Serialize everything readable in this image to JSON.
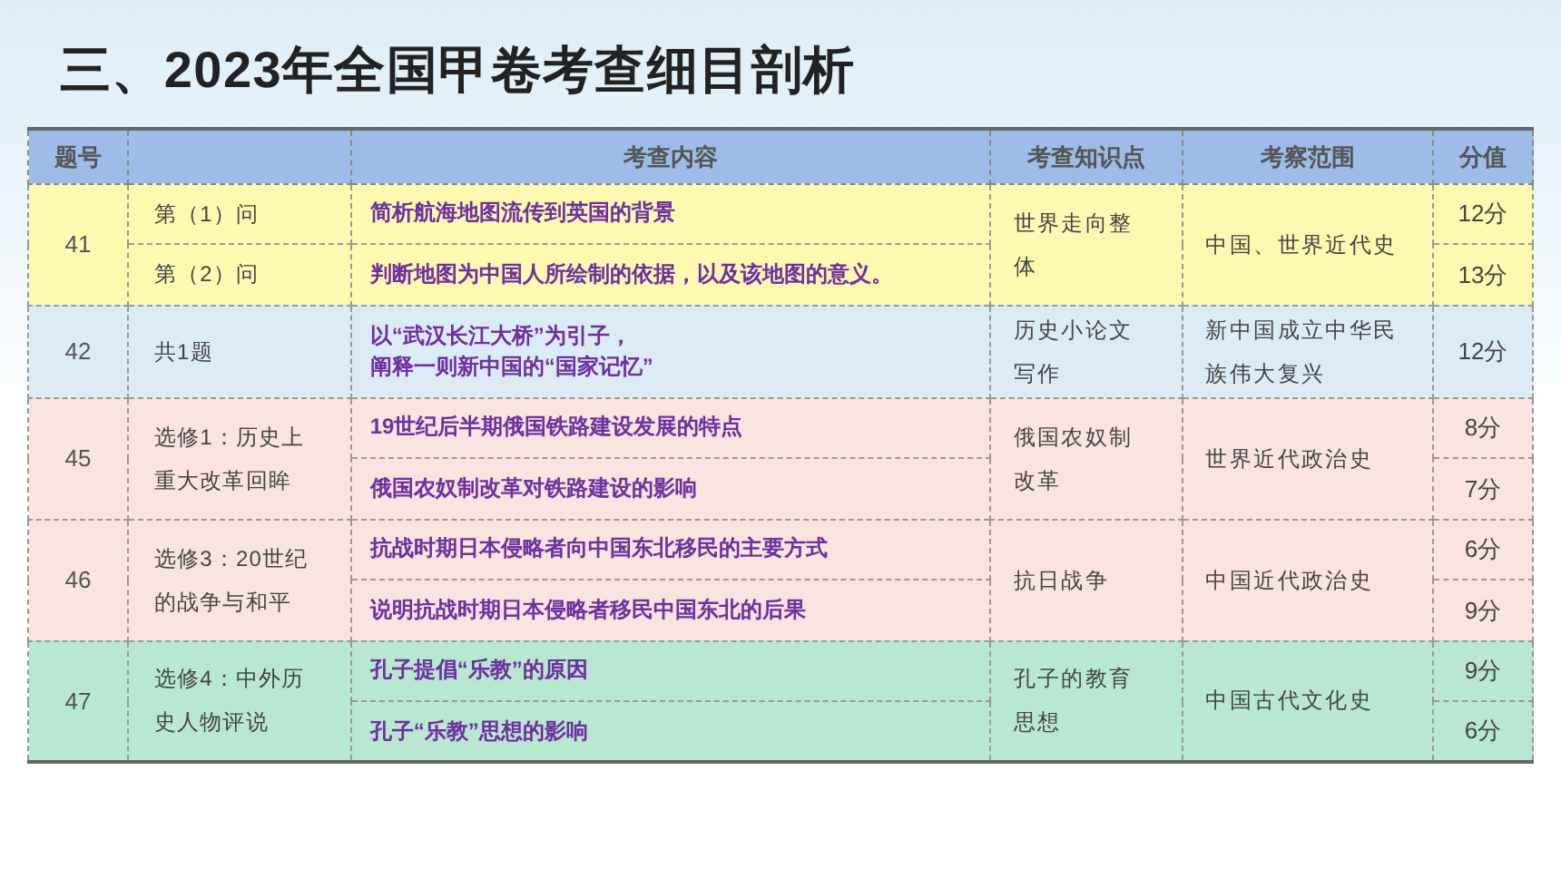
{
  "title": "三、2023年全国甲卷考查细目剖析",
  "table": {
    "columns": [
      "题号",
      "",
      "考查内容",
      "考查知识点",
      "考察范围",
      "分值"
    ],
    "groups": [
      {
        "number": "41",
        "color": "#fdf9b0",
        "knowledge": "世界走向整体",
        "scope": "中国、世界近代史",
        "items": [
          {
            "label": "第（1）问",
            "content": "简析航海地图流传到英国的背景",
            "score": "12分"
          },
          {
            "label": "第（2）问",
            "content": "判断地图为中国人所绘制的依据，以及该地图的意义。",
            "score": "13分"
          }
        ]
      },
      {
        "number": "42",
        "color": "#dcecf7",
        "label": "共1题",
        "knowledge": "历史小论文写作",
        "scope": "新中国成立中华民族伟大复兴",
        "items": [
          {
            "content": [
              "以“武汉长江大桥”为引子，",
              "阐释一则新中国的“国家记忆”"
            ],
            "score": "12分"
          }
        ]
      },
      {
        "number": "45",
        "color": "#f9e4df",
        "label": "选修1：历史上重大改革回眸",
        "knowledge": "俄国农奴制改革",
        "scope": "世界近代政治史",
        "items": [
          {
            "content": "19世纪后半期俄国铁路建设发展的特点",
            "score": "8分"
          },
          {
            "content": "俄国农奴制改革对铁路建设的影响",
            "score": "7分"
          }
        ]
      },
      {
        "number": "46",
        "color": "#f9e4df",
        "label": "选修3：20世纪的战争与和平",
        "knowledge": "抗日战争",
        "scope": "中国近代政治史",
        "items": [
          {
            "content": "抗战时期日本侵略者向中国东北移民的主要方式",
            "score": "6分"
          },
          {
            "content": "说明抗战时期日本侵略者移民中国东北的后果",
            "score": "9分"
          }
        ]
      },
      {
        "number": "47",
        "color": "#b8e8d1",
        "label": "选修4：中外历史人物评说",
        "knowledge": "孔子的教育思想",
        "scope": "中国古代文化史",
        "items": [
          {
            "content": "孔子提倡“乐教”的原因",
            "score": "9分"
          },
          {
            "content": "孔子“乐教”思想的影响",
            "score": "6分"
          }
        ]
      }
    ]
  }
}
